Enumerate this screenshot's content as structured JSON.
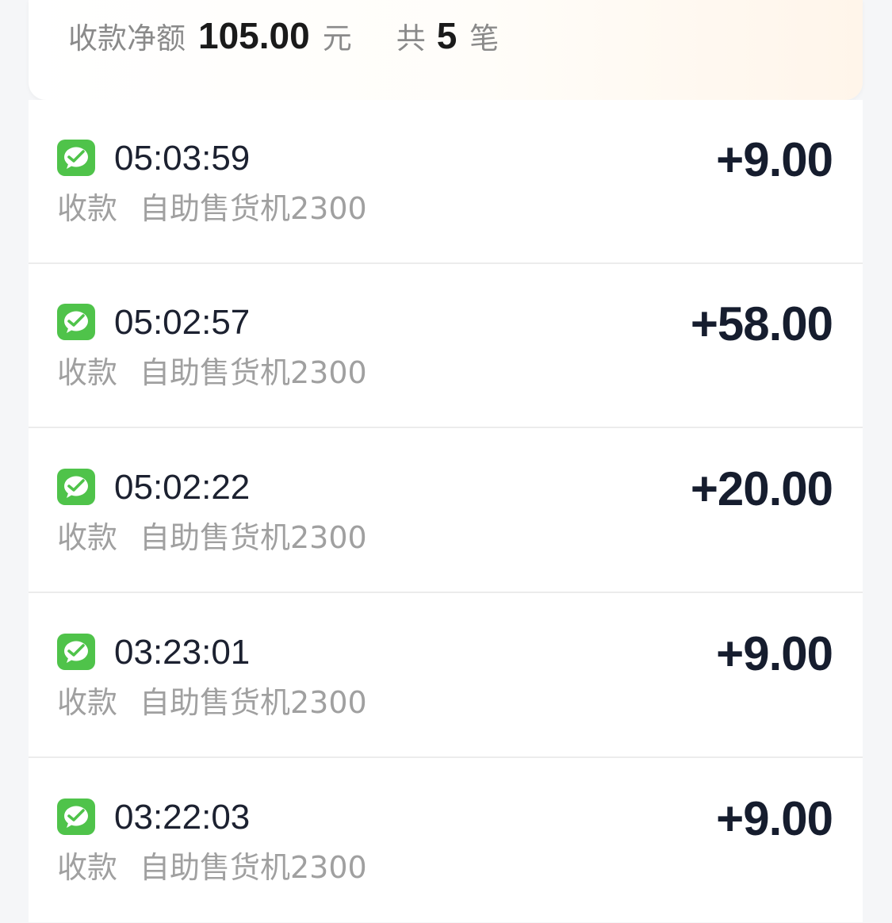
{
  "summary": {
    "label": "收款净额",
    "amount": "105.00",
    "unit": "元",
    "count_prefix": "共",
    "count": "5",
    "count_suffix": "笔"
  },
  "icon": "wechat-pay-icon",
  "colors": {
    "wechat_green": "#4fc34a",
    "amount_text": "#161d2e",
    "secondary_text": "#a0a0a0"
  },
  "transactions": [
    {
      "time": "05:03:59",
      "type": "收款",
      "desc": "自助售货机2300",
      "amount": "+9.00"
    },
    {
      "time": "05:02:57",
      "type": "收款",
      "desc": "自助售货机2300",
      "amount": "+58.00"
    },
    {
      "time": "05:02:22",
      "type": "收款",
      "desc": "自助售货机2300",
      "amount": "+20.00"
    },
    {
      "time": "03:23:01",
      "type": "收款",
      "desc": "自助售货机2300",
      "amount": "+9.00"
    },
    {
      "time": "03:22:03",
      "type": "收款",
      "desc": "自助售货机2300",
      "amount": "+9.00"
    }
  ]
}
